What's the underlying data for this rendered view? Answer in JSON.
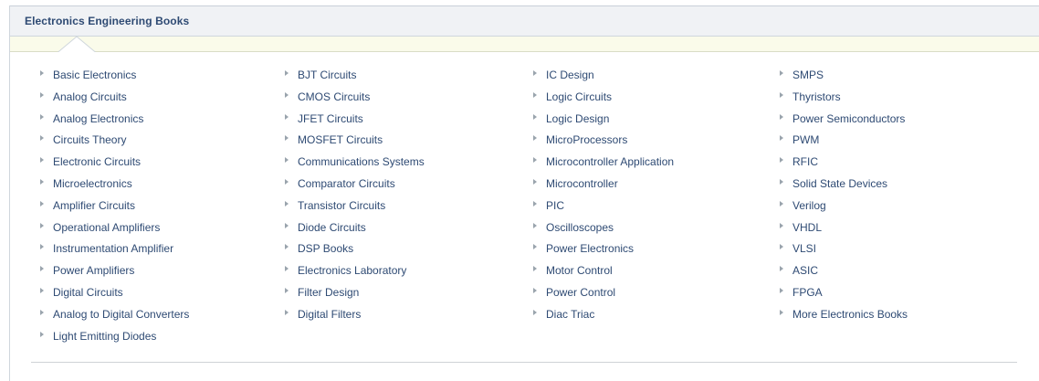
{
  "header": {
    "title": "Electronics Engineering Books"
  },
  "columns": [
    {
      "items": [
        "Basic Electronics",
        "Analog Circuits",
        "Analog Electronics",
        "Circuits Theory",
        "Electronic Circuits",
        "Microelectronics",
        "Amplifier Circuits",
        "Operational Amplifiers",
        "Instrumentation Amplifier",
        "Power Amplifiers",
        "Digital Circuits",
        "Analog to Digital Converters",
        "Light Emitting Diodes"
      ]
    },
    {
      "items": [
        "BJT Circuits",
        "CMOS Circuits",
        "JFET Circuits",
        "MOSFET Circuits",
        "Communications Systems",
        "Comparator Circuits",
        "Transistor Circuits",
        "Diode Circuits",
        "DSP Books",
        "Electronics Laboratory",
        "Filter Design",
        "Digital Filters"
      ]
    },
    {
      "items": [
        "IC Design",
        "Logic Circuits",
        "Logic Design",
        "MicroProcessors",
        "Microcontroller Application",
        "Microcontroller",
        "PIC",
        "Oscilloscopes",
        "Power Electronics",
        "Motor Control",
        "Power Control",
        "Diac Triac"
      ]
    },
    {
      "items": [
        "SMPS",
        "Thyristors",
        "Power Semiconductors",
        "PWM",
        "RFIC",
        "Solid State Devices",
        "Verilog",
        "VHDL",
        "VLSI",
        "ASIC",
        "FPGA",
        "More Electronics Books"
      ]
    }
  ],
  "colors": {
    "link": "#2e4a73",
    "header_bg": "#f0f2f5",
    "subbar_bg": "#fafbea",
    "arrow": "#9aa4ad"
  },
  "icons": {
    "bullet": "bullet-arrow-icon"
  }
}
